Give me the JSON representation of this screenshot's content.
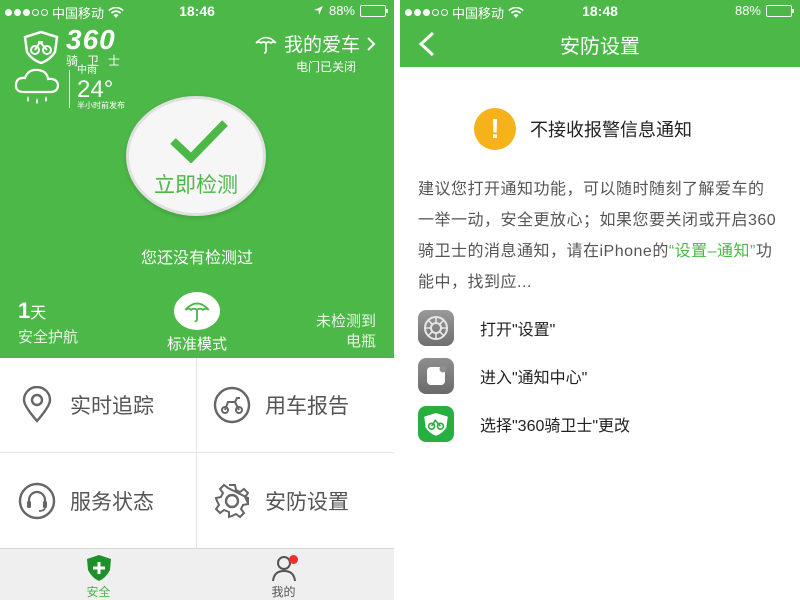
{
  "left": {
    "status": {
      "carrier": "中国移动",
      "time": "18:46",
      "battery": "88%"
    },
    "brand": {
      "name": "360",
      "sub": "骑卫士"
    },
    "my_car": {
      "label": "我的爱车",
      "door": "电门已关闭"
    },
    "weather": {
      "condition": "中雨",
      "temp": "24°",
      "note": "半小时前发布"
    },
    "check_button": "立即检测",
    "not_detected": "您还没有检测过",
    "stats": {
      "days_num": "1",
      "days_unit": "天",
      "days_label": "安全护航",
      "mode_label": "标准模式",
      "right_line1": "未检测到",
      "right_line2": "电瓶"
    },
    "grid": [
      {
        "label": "实时追踪",
        "icon": "location-pin-icon"
      },
      {
        "label": "用车报告",
        "icon": "scooter-icon"
      },
      {
        "label": "服务状态",
        "icon": "headset-icon"
      },
      {
        "label": "安防设置",
        "icon": "gear-icon"
      }
    ],
    "tabs": [
      {
        "label": "安全",
        "icon": "shield-plus-icon",
        "active": true
      },
      {
        "label": "我的",
        "icon": "user-icon",
        "badge": true
      }
    ],
    "accent": "#4cb847"
  },
  "right": {
    "status": {
      "carrier": "中国移动",
      "time": "18:48",
      "battery": "88%"
    },
    "title": "安防设置",
    "warning": "不接收报警信息通知",
    "desc_part1": "建议您打开通知功能，可以随时随刻了解爱车的一举一动，安全更放心；如果您要关闭或开启360骑卫士的消息通知，请在iPhone的",
    "desc_highlight": "“设置–通知”",
    "desc_part2": "功能中，找到应...",
    "steps": [
      {
        "label": "打开\"设置\"",
        "icon": "settings-app-icon"
      },
      {
        "label": "进入\"通知中心\"",
        "icon": "notification-center-icon"
      },
      {
        "label": "选择\"360骑卫士\"更改",
        "icon": "app-360-icon"
      }
    ],
    "warn_color": "#f5b21b"
  }
}
